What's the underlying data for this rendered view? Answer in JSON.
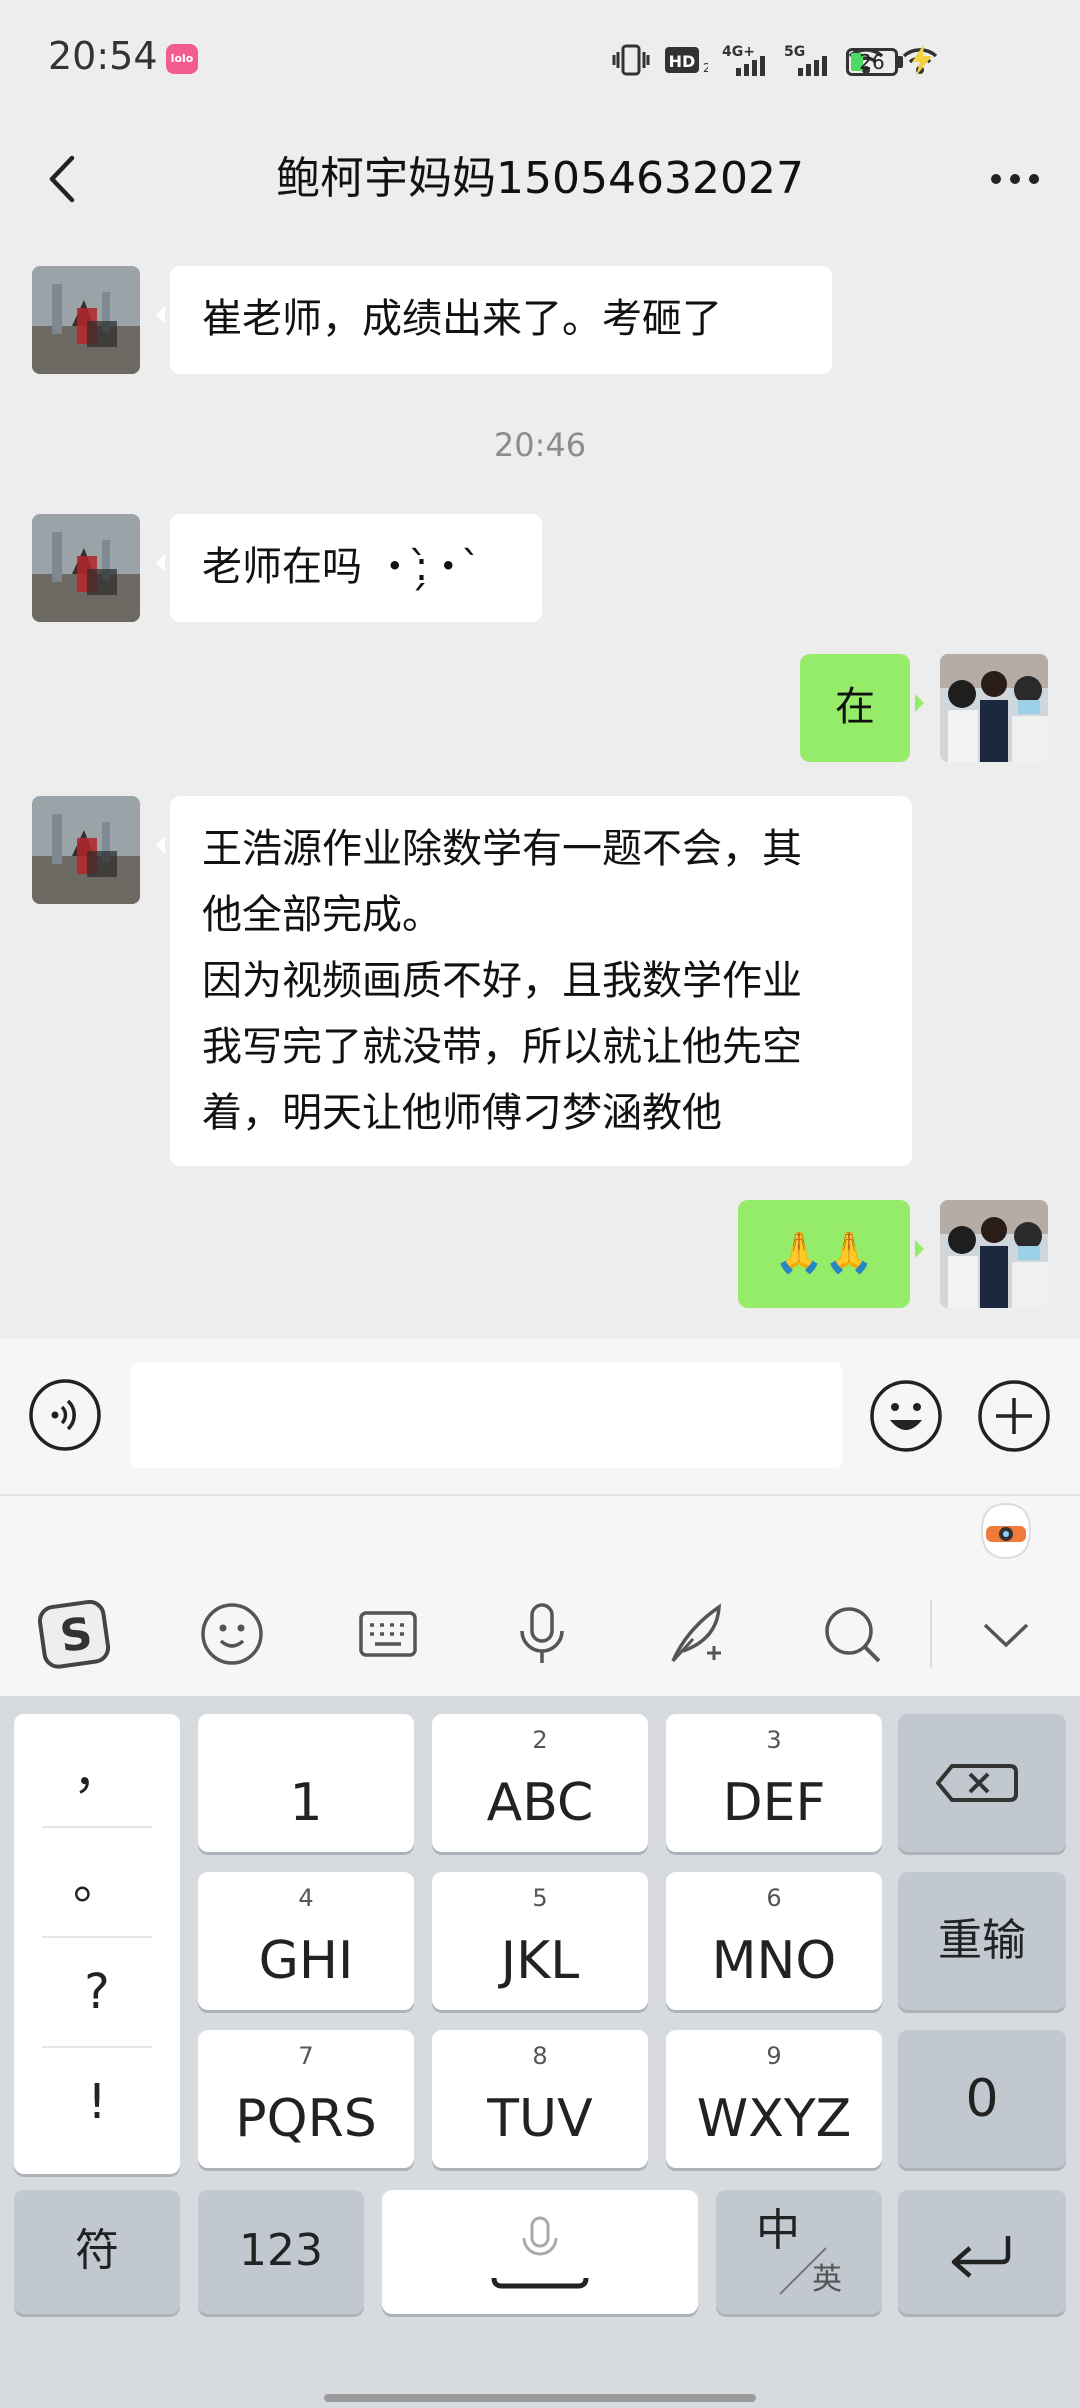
{
  "status": {
    "time": "20:54",
    "app_badge": "lolo",
    "hd": "HD",
    "net_4g": "4G+",
    "net_5g": "5G",
    "battery": "26",
    "accent_battery": "#4cd964"
  },
  "header": {
    "title": "鲍柯宇妈妈15054632027"
  },
  "messages": {
    "m1": "崔老师，成绩出来了。考砸了",
    "ts1": "20:46",
    "m2": "老师在吗 ・:̗̀・ ̀",
    "m3": "在",
    "m4_lines": [
      "王浩源作业除数学有一题不会，其",
      "他全部完成。",
      "因为视频画质不好，且我数学作业",
      "我写完了就没带，所以就让他先空",
      "着，明天让他师傅刁梦涵教他"
    ],
    "m5": "🙏🙏"
  },
  "input": {
    "placeholder": ""
  },
  "keyboard": {
    "punctuation": [
      "，",
      "。",
      "?",
      "!"
    ],
    "keys": [
      {
        "num": "",
        "label": "1"
      },
      {
        "num": "2",
        "label": "ABC"
      },
      {
        "num": "3",
        "label": "DEF"
      },
      {
        "num": "4",
        "label": "GHI"
      },
      {
        "num": "5",
        "label": "JKL"
      },
      {
        "num": "6",
        "label": "MNO"
      },
      {
        "num": "7",
        "label": "PQRS"
      },
      {
        "num": "8",
        "label": "TUV"
      },
      {
        "num": "9",
        "label": "WXYZ"
      }
    ],
    "reset": "重输",
    "zero": "0",
    "symbols": "符",
    "num123": "123",
    "lang_cn": "中",
    "lang_en": "英"
  },
  "colors": {
    "bubble_out": "#95ec69",
    "bubble_in": "#ffffff",
    "chat_bg": "#ededed",
    "keyboard_bg": "#d7dbe0"
  }
}
